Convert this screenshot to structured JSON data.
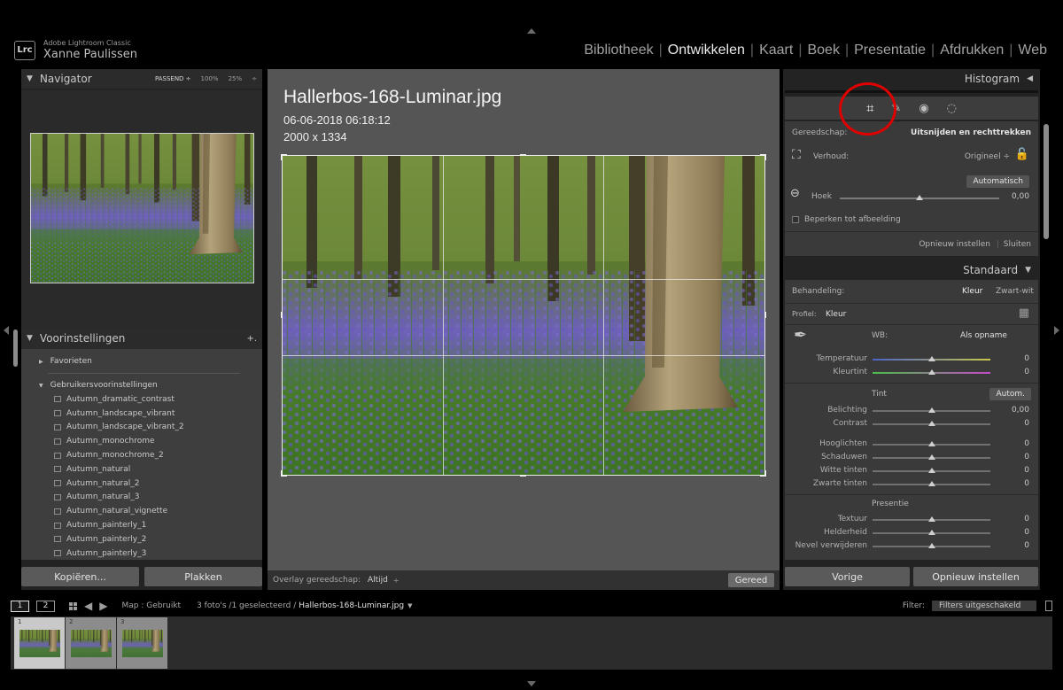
{
  "app": {
    "badge": "Lrc",
    "product": "Adobe Lightroom Classic",
    "user": "Xanne Paulissen"
  },
  "modules": [
    {
      "label": "Bibliotheek",
      "active": false
    },
    {
      "label": "Ontwikkelen",
      "active": true
    },
    {
      "label": "Kaart",
      "active": false
    },
    {
      "label": "Boek",
      "active": false
    },
    {
      "label": "Presentatie",
      "active": false
    },
    {
      "label": "Afdrukken",
      "active": false
    },
    {
      "label": "Web",
      "active": false
    }
  ],
  "navigator": {
    "title": "Navigator",
    "zoom": [
      "PASSEND ÷",
      "100%",
      "25%",
      "÷"
    ]
  },
  "presets": {
    "title": "Voorinstellingen",
    "add": "+.",
    "favorites": "Favorieten",
    "user_folder": "Gebruikersvoorinstellingen",
    "items": [
      "Autumn_dramatic_contrast",
      "Autumn_landscape_vibrant",
      "Autumn_landscape_vibrant_2",
      "Autumn_monochrome",
      "Autumn_monochrome_2",
      "Autumn_natural",
      "Autumn_natural_2",
      "Autumn_natural_3",
      "Autumn_natural_vignette",
      "Autumn_painterly_1",
      "Autumn_painterly_2",
      "Autumn_painterly_3"
    ],
    "copy": "Kopiëren...",
    "paste": "Plakken"
  },
  "photo": {
    "filename": "Hallerbos-168-Luminar.jpg",
    "datetime": "06-06-2018 06:18:12",
    "dimensions": "2000 x 1334"
  },
  "center_toolbar": {
    "overlay_label": "Overlay gereedschap:",
    "overlay_value": "Altijd",
    "done": "Gereed"
  },
  "histogram": {
    "title": "Histogram"
  },
  "crop": {
    "tool_label": "Gereedschap:",
    "tool_value": "Uitsnijden en rechttrekken",
    "aspect_label": "Verhoud:",
    "aspect_value": "Origineel ÷",
    "auto": "Automatisch",
    "angle_label": "Hoek",
    "angle_value": "0,00",
    "constrain": "Beperken tot afbeelding",
    "reset": "Opnieuw instellen",
    "close": "Sluiten",
    "angle": 0.0,
    "angle_range": [
      -45,
      45
    ]
  },
  "basic": {
    "title": "Standaard",
    "treatment_label": "Behandeling:",
    "color": "Kleur",
    "bw": "Zwart-wit",
    "profile_label": "Profiel:",
    "profile_value": "Kleur",
    "wb_label": "WB:",
    "wb_value": "Als opname",
    "tone_title": "Tint",
    "auto": "Autom.",
    "presence_title": "Presentie",
    "sliders": {
      "temperature": {
        "label": "Temperatuur",
        "value": "0"
      },
      "tint": {
        "label": "Kleurtint",
        "value": "0"
      },
      "exposure": {
        "label": "Belichting",
        "value": "0,00"
      },
      "contrast": {
        "label": "Contrast",
        "value": "0"
      },
      "highlights": {
        "label": "Hooglichten",
        "value": "0"
      },
      "shadows": {
        "label": "Schaduwen",
        "value": "0"
      },
      "whites": {
        "label": "Witte tinten",
        "value": "0"
      },
      "blacks": {
        "label": "Zwarte tinten",
        "value": "0"
      },
      "texture": {
        "label": "Textuur",
        "value": "0"
      },
      "clarity": {
        "label": "Helderheid",
        "value": "0"
      },
      "dehaze": {
        "label": "Nevel verwijderen",
        "value": "0"
      }
    }
  },
  "right_buttons": {
    "previous": "Vorige",
    "reset": "Opnieuw instellen"
  },
  "filmstrip": {
    "view1": "1",
    "view2": "2",
    "source": "Map : Gebruikt",
    "count": "3 foto's /1 geselecteerd /",
    "current": "Hallerbos-168-Luminar.jpg",
    "filter_label": "Filter:",
    "filter_value": "Filters uitgeschakeld",
    "items": [
      "1",
      "2",
      "3"
    ]
  },
  "colors": {
    "accent_annotation": "#e00000",
    "panel_bg": "#3a3a3a",
    "canvas_bg": "#555555"
  }
}
